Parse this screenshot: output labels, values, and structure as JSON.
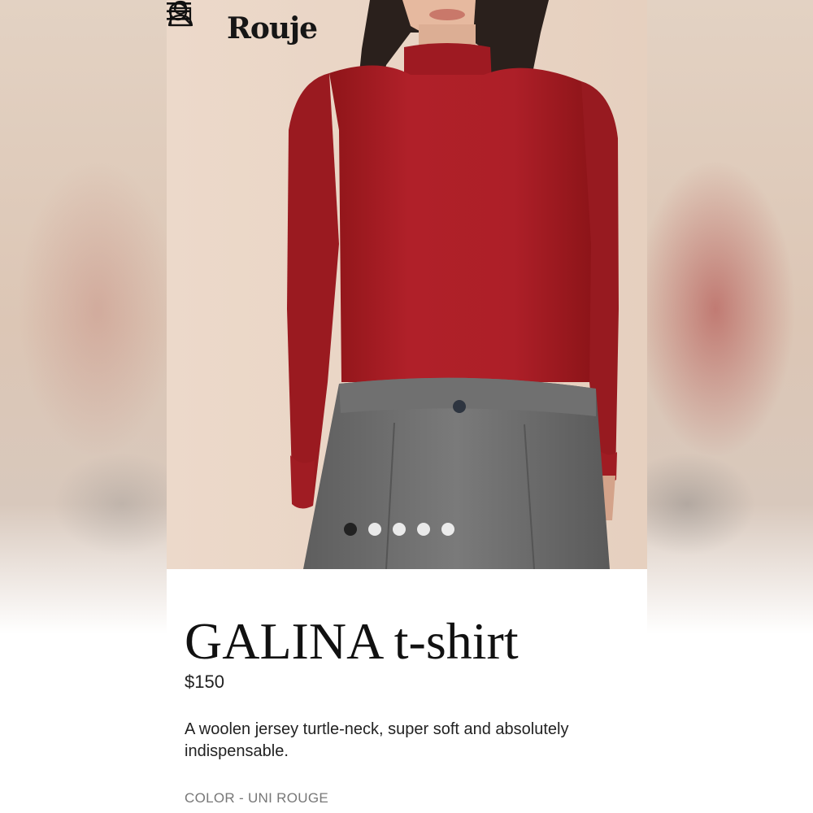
{
  "brand": {
    "logo": "Rouje"
  },
  "header": {
    "icons": [
      "menu-icon",
      "search-icon",
      "account-icon",
      "shopping-bag-icon"
    ]
  },
  "carousel": {
    "total_slides": 5,
    "active_index": 0
  },
  "product": {
    "title": "GALINA t-shirt",
    "price": "$150",
    "description": "A woolen jersey turtle-neck, super soft and absolutely indispensable.",
    "color_label": "COLOR -",
    "color_value": "UNI ROUGE"
  },
  "colors": {
    "shirt": "#a81c24",
    "skirt": "#6b6b6b",
    "hero_bg": "#ead6c6",
    "text": "#111111"
  }
}
